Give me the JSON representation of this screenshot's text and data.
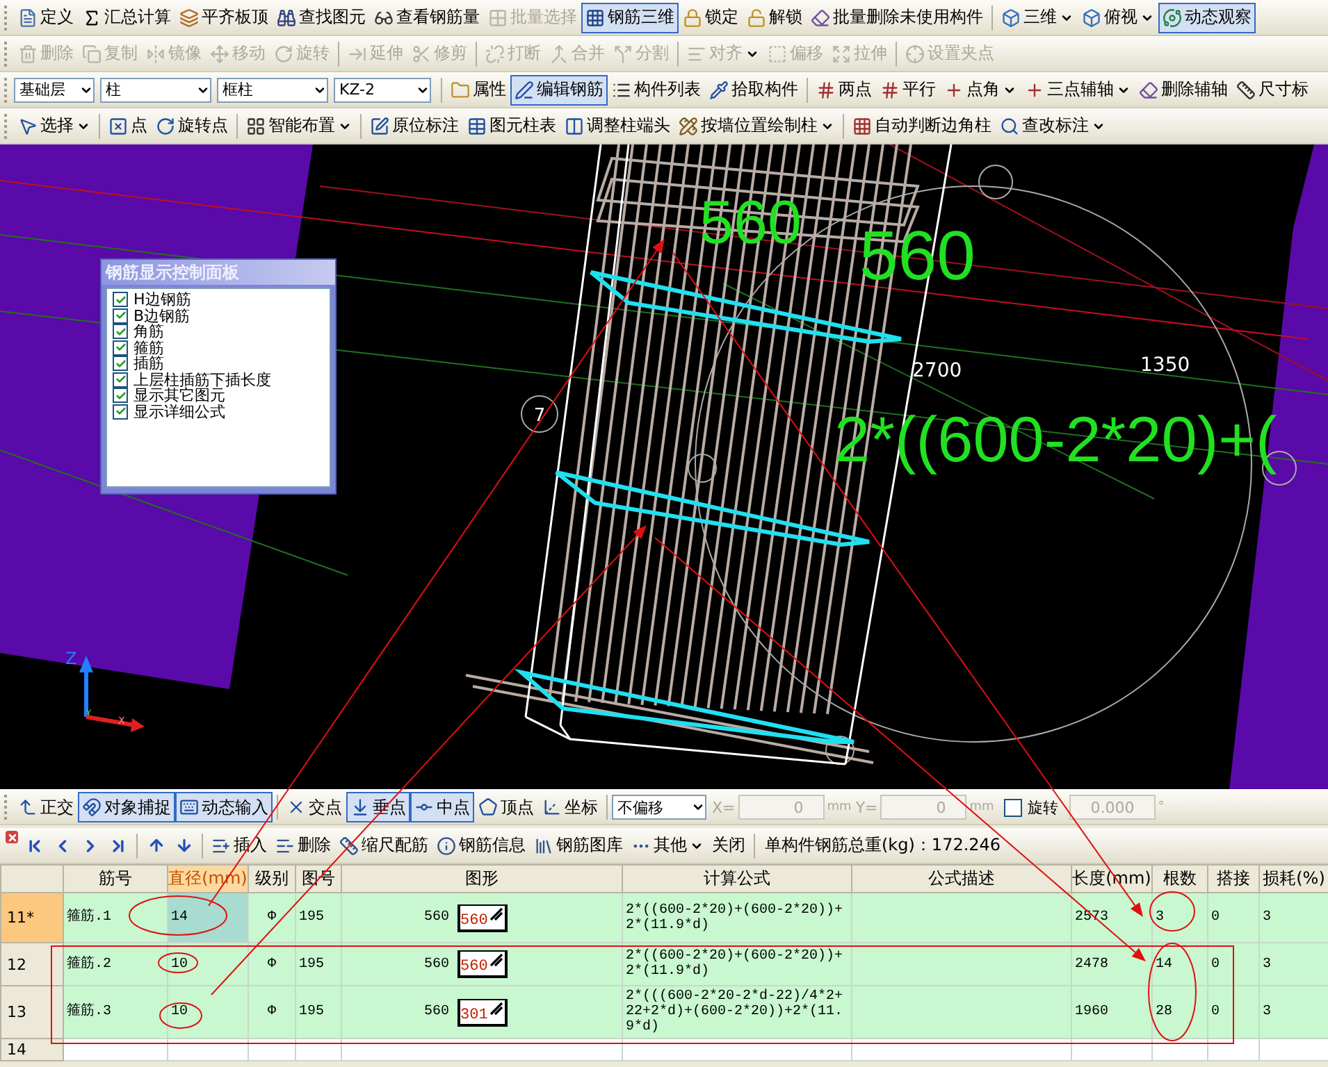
{
  "toolbars": [
    {
      "groups": [
        {
          "items": [
            {
              "label": "定义",
              "kind": "button",
              "pressed": false,
              "disabled": false
            },
            {
              "label": "汇总计算",
              "kind": "button",
              "pressed": false,
              "disabled": false
            },
            {
              "label": "平齐板顶",
              "kind": "button",
              "pressed": false,
              "disabled": false
            },
            {
              "label": "查找图元",
              "kind": "button",
              "pressed": false,
              "disabled": false
            },
            {
              "label": "查看钢筋量",
              "kind": "button",
              "pressed": false,
              "disabled": false
            },
            {
              "label": "批量选择",
              "kind": "button",
              "pressed": false,
              "disabled": true
            },
            {
              "label": "钢筋三维",
              "kind": "button",
              "pressed": true,
              "disabled": false
            },
            {
              "label": "锁定",
              "kind": "button",
              "pressed": false,
              "disabled": false
            },
            {
              "label": "解锁",
              "kind": "button",
              "pressed": false,
              "disabled": false
            },
            {
              "label": "批量删除未使用构件",
              "kind": "button",
              "pressed": false,
              "disabled": false
            }
          ]
        },
        {
          "items": [
            {
              "label": "三维",
              "kind": "dropdown",
              "pressed": false,
              "disabled": false
            },
            {
              "label": "俯视",
              "kind": "dropdown",
              "pressed": false,
              "disabled": false
            },
            {
              "label": "动态观察",
              "kind": "button",
              "pressed": true,
              "disabled": false
            }
          ]
        }
      ]
    },
    {
      "groups": [
        {
          "items": [
            {
              "label": "删除",
              "kind": "button",
              "pressed": false,
              "disabled": true
            },
            {
              "label": "复制",
              "kind": "button",
              "pressed": false,
              "disabled": true
            },
            {
              "label": "镜像",
              "kind": "button",
              "pressed": false,
              "disabled": true
            },
            {
              "label": "移动",
              "kind": "button",
              "pressed": false,
              "disabled": true
            },
            {
              "label": "旋转",
              "kind": "button",
              "pressed": false,
              "disabled": true
            }
          ]
        },
        {
          "items": [
            {
              "label": "延伸",
              "kind": "button",
              "pressed": false,
              "disabled": true
            },
            {
              "label": "修剪",
              "kind": "button",
              "pressed": false,
              "disabled": true
            }
          ]
        },
        {
          "items": [
            {
              "label": "打断",
              "kind": "button",
              "pressed": false,
              "disabled": true
            },
            {
              "label": "合并",
              "kind": "button",
              "pressed": false,
              "disabled": true
            },
            {
              "label": "分割",
              "kind": "button",
              "pressed": false,
              "disabled": true
            }
          ]
        },
        {
          "items": [
            {
              "label": "对齐",
              "kind": "dropdown",
              "pressed": false,
              "disabled": true
            },
            {
              "label": "偏移",
              "kind": "button",
              "pressed": false,
              "disabled": true
            },
            {
              "label": "拉伸",
              "kind": "button",
              "pressed": false,
              "disabled": true
            }
          ]
        },
        {
          "items": [
            {
              "label": "设置夹点",
              "kind": "button",
              "pressed": false,
              "disabled": true
            }
          ]
        }
      ]
    },
    {
      "groups": [
        {
          "items": [
            {
              "label": "基础层",
              "kind": "combo"
            },
            {
              "label": "柱",
              "kind": "combo"
            },
            {
              "label": "框柱",
              "kind": "combo"
            },
            {
              "label": "KZ-2",
              "kind": "combo"
            }
          ]
        },
        {
          "items": [
            {
              "label": "属性",
              "kind": "button",
              "pressed": false,
              "disabled": false
            },
            {
              "label": "编辑钢筋",
              "kind": "button",
              "pressed": true,
              "disabled": false
            },
            {
              "label": "构件列表",
              "kind": "button",
              "pressed": false,
              "disabled": false
            },
            {
              "label": "拾取构件",
              "kind": "button",
              "pressed": false,
              "disabled": false
            }
          ]
        },
        {
          "items": [
            {
              "label": "两点",
              "kind": "button",
              "pressed": false,
              "disabled": false
            },
            {
              "label": "平行",
              "kind": "button",
              "pressed": false,
              "disabled": false
            },
            {
              "label": "点角",
              "kind": "dropdown",
              "pressed": false,
              "disabled": false
            },
            {
              "label": "三点辅轴",
              "kind": "dropdown",
              "pressed": false,
              "disabled": false
            },
            {
              "label": "删除辅轴",
              "kind": "button",
              "pressed": false,
              "disabled": false
            },
            {
              "label": "尺寸标",
              "kind": "button",
              "pressed": false,
              "disabled": false
            }
          ]
        }
      ]
    },
    {
      "groups": [
        {
          "items": [
            {
              "label": "选择",
              "kind": "dropdown",
              "pressed": false,
              "disabled": false
            }
          ]
        },
        {
          "items": [
            {
              "label": "点",
              "kind": "button",
              "pressed": false,
              "disabled": false
            },
            {
              "label": "旋转点",
              "kind": "button",
              "pressed": false,
              "disabled": false
            }
          ]
        },
        {
          "items": [
            {
              "label": "智能布置",
              "kind": "dropdown",
              "pressed": false,
              "disabled": false
            }
          ]
        },
        {
          "items": [
            {
              "label": "原位标注",
              "kind": "button",
              "pressed": false,
              "disabled": false
            },
            {
              "label": "图元柱表",
              "kind": "button",
              "pressed": false,
              "disabled": false
            },
            {
              "label": "调整柱端头",
              "kind": "button",
              "pressed": false,
              "disabled": false
            },
            {
              "label": "按墙位置绘制柱",
              "kind": "dropdown",
              "pressed": false,
              "disabled": false
            }
          ]
        },
        {
          "items": [
            {
              "label": "自动判断边角柱",
              "kind": "button",
              "pressed": false,
              "disabled": false
            },
            {
              "label": "查改标注",
              "kind": "dropdown",
              "pressed": false,
              "disabled": false
            }
          ]
        }
      ]
    }
  ],
  "viewport": {
    "labels": [
      {
        "text": "560",
        "kind": "big"
      },
      {
        "text": "560",
        "kind": "big"
      },
      {
        "text": "2700",
        "kind": "small"
      },
      {
        "text": "1350",
        "kind": "small"
      },
      {
        "text": "7",
        "kind": "axis_mark"
      },
      {
        "text": "2*((600-2*20)+(",
        "kind": "big"
      }
    ],
    "axes": {
      "z": "Z",
      "x": "X",
      "y": "Y"
    },
    "control_panel": {
      "title": "钢筋显示控制面板",
      "items": [
        {
          "label": "H边钢筋",
          "checked": true
        },
        {
          "label": "B边钢筋",
          "checked": true
        },
        {
          "label": "角筋",
          "checked": true
        },
        {
          "label": "箍筋",
          "checked": true
        },
        {
          "label": "插筋",
          "checked": true
        },
        {
          "label": "上层柱插筋下插长度",
          "checked": true
        },
        {
          "label": "显示其它图元",
          "checked": true
        },
        {
          "label": "显示详细公式",
          "checked": true
        }
      ]
    }
  },
  "snap_bar": {
    "buttons": [
      {
        "label": "正交",
        "pressed": false
      },
      {
        "label": "对象捕捉",
        "pressed": true
      },
      {
        "label": "动态输入",
        "pressed": true
      },
      {
        "label": "交点",
        "pressed": false
      },
      {
        "label": "垂点",
        "pressed": true
      },
      {
        "label": "中点",
        "pressed": true
      },
      {
        "label": "顶点",
        "pressed": false
      },
      {
        "label": "坐标",
        "pressed": false
      }
    ],
    "offset_mode": "不偏移",
    "x_field": {
      "label": "X=",
      "value": "0",
      "unit": "mm",
      "disabled": true
    },
    "y_field": {
      "label": "Y=",
      "value": "0",
      "unit": "mm",
      "disabled": true
    },
    "rotate": {
      "label": "旋转",
      "checked": false,
      "value": "0.000",
      "unit": "°",
      "disabled": true
    }
  },
  "table_toolbar": {
    "buttons": [
      {
        "label": "插入",
        "kind": "button"
      },
      {
        "label": "删除",
        "kind": "button"
      },
      {
        "label": "缩尺配筋",
        "kind": "button"
      },
      {
        "label": "钢筋信息",
        "kind": "button"
      },
      {
        "label": "钢筋图库",
        "kind": "button"
      },
      {
        "label": "其他",
        "kind": "dropdown"
      },
      {
        "label": "关闭",
        "kind": "plain"
      }
    ],
    "total_weight": "单构件钢筋总重(kg)：172.246"
  },
  "table": {
    "columns": [
      {
        "label": "筋号",
        "selected": false
      },
      {
        "label": "直径(mm)",
        "selected": true
      },
      {
        "label": "级别",
        "selected": false
      },
      {
        "label": "图号",
        "selected": false
      },
      {
        "label": "图形",
        "selected": false
      },
      {
        "label": "计算公式",
        "selected": false
      },
      {
        "label": "公式描述",
        "selected": false
      },
      {
        "label": "长度(mm)",
        "selected": false
      },
      {
        "label": "根数",
        "selected": false
      },
      {
        "label": "搭接",
        "selected": false
      },
      {
        "label": "损耗(%)",
        "selected": false
      }
    ],
    "rows": [
      {
        "number": "11*",
        "selected": true,
        "bar_no": "箍筋.1",
        "diameter": "14",
        "grade": "Φ",
        "figure_no": "195",
        "shape": {
          "dimension": "560",
          "label": "560"
        },
        "formula": "2*((600-2*20)+(600-2*20))+2*(11.9*d)",
        "length": "2573",
        "count": "3",
        "lap": "0",
        "loss": "3"
      },
      {
        "number": "12",
        "selected": false,
        "bar_no": "箍筋.2",
        "diameter": "10",
        "grade": "Φ",
        "figure_no": "195",
        "shape": {
          "dimension": "560",
          "label": "560"
        },
        "formula": "2*((600-2*20)+(600-2*20))+2*(11.9*d)",
        "length": "2478",
        "count": "14",
        "lap": "0",
        "loss": "3"
      },
      {
        "number": "13",
        "selected": false,
        "bar_no": "箍筋.3",
        "diameter": "10",
        "grade": "Φ",
        "figure_no": "195",
        "shape": {
          "dimension": "560",
          "label": "301"
        },
        "formula": "2*(((600-2*20-2*d-22)/4*2+22+2*d)+(600-2*20))+2*(11.9*d)",
        "length": "1960",
        "count": "28",
        "lap": "0",
        "loss": "3"
      },
      {
        "number": "14",
        "selected": false
      }
    ]
  }
}
